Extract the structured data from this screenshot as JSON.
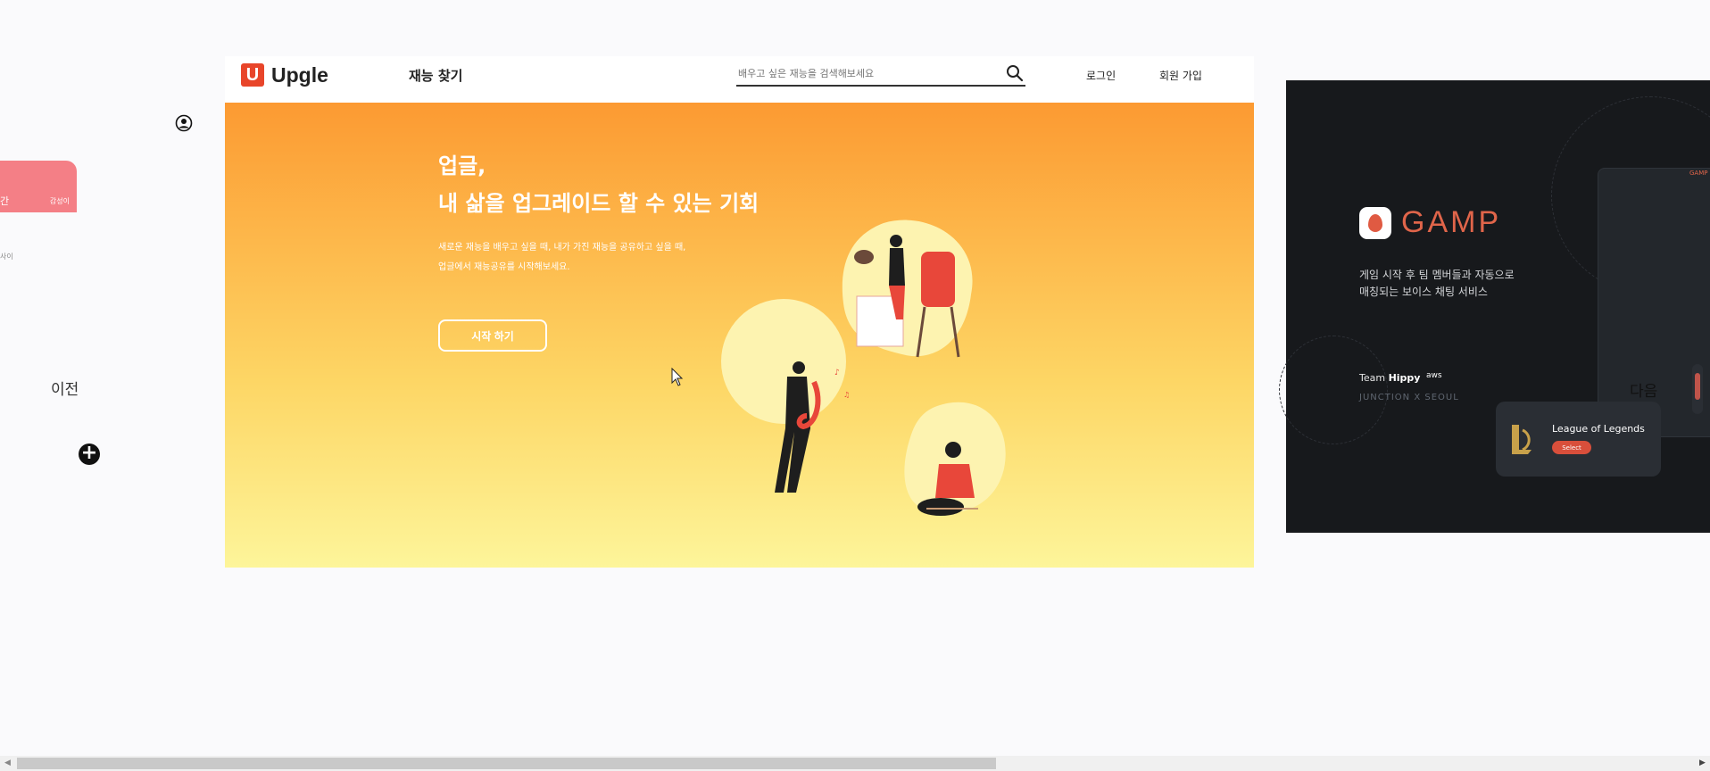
{
  "left": {
    "card_text_1": "간",
    "card_text_2": "감성이",
    "snippet": "사이",
    "prev_label": "이전",
    "add_button": "+"
  },
  "nav": {
    "logo_mark": "U",
    "logo_text": "Upgle",
    "find_talent": "재능 찾기",
    "search_placeholder": "배우고 싶은 재능을 검색해보세요",
    "login": "로그인",
    "signup": "회원 가입"
  },
  "hero": {
    "title_line1": "업글,",
    "title_line2": "내 삶을 업그레이드 할 수 있는 기회",
    "subtitle_line1": "새로운 재능을 배우고 싶을 때, 내가 가진 재능을 공유하고 싶을 때,",
    "subtitle_line2": "업글에서 재능공유를 시작해보세요.",
    "cta": "시작 하기"
  },
  "gamp": {
    "wordmark": "GAMP",
    "desc_line1": "게임 시작 후 팀 멤버들과 자동으로",
    "desc_line2": "매칭되는 보이스 채팅 서비스",
    "team_prefix": "Team ",
    "team_name": "Hippy",
    "aws_label": "aws",
    "junction": "JUNCTION X SEOUL",
    "device_label": "GAMP",
    "game_name": "League of Legends",
    "select_button": "Select",
    "next_label": "다음"
  },
  "colors": {
    "hero_top": "#fc9a32",
    "hero_bottom": "#fdf59a",
    "brand_upgle": "#e8452a",
    "brand_gamp": "#e0654a",
    "gamp_bg": "#17191c"
  }
}
